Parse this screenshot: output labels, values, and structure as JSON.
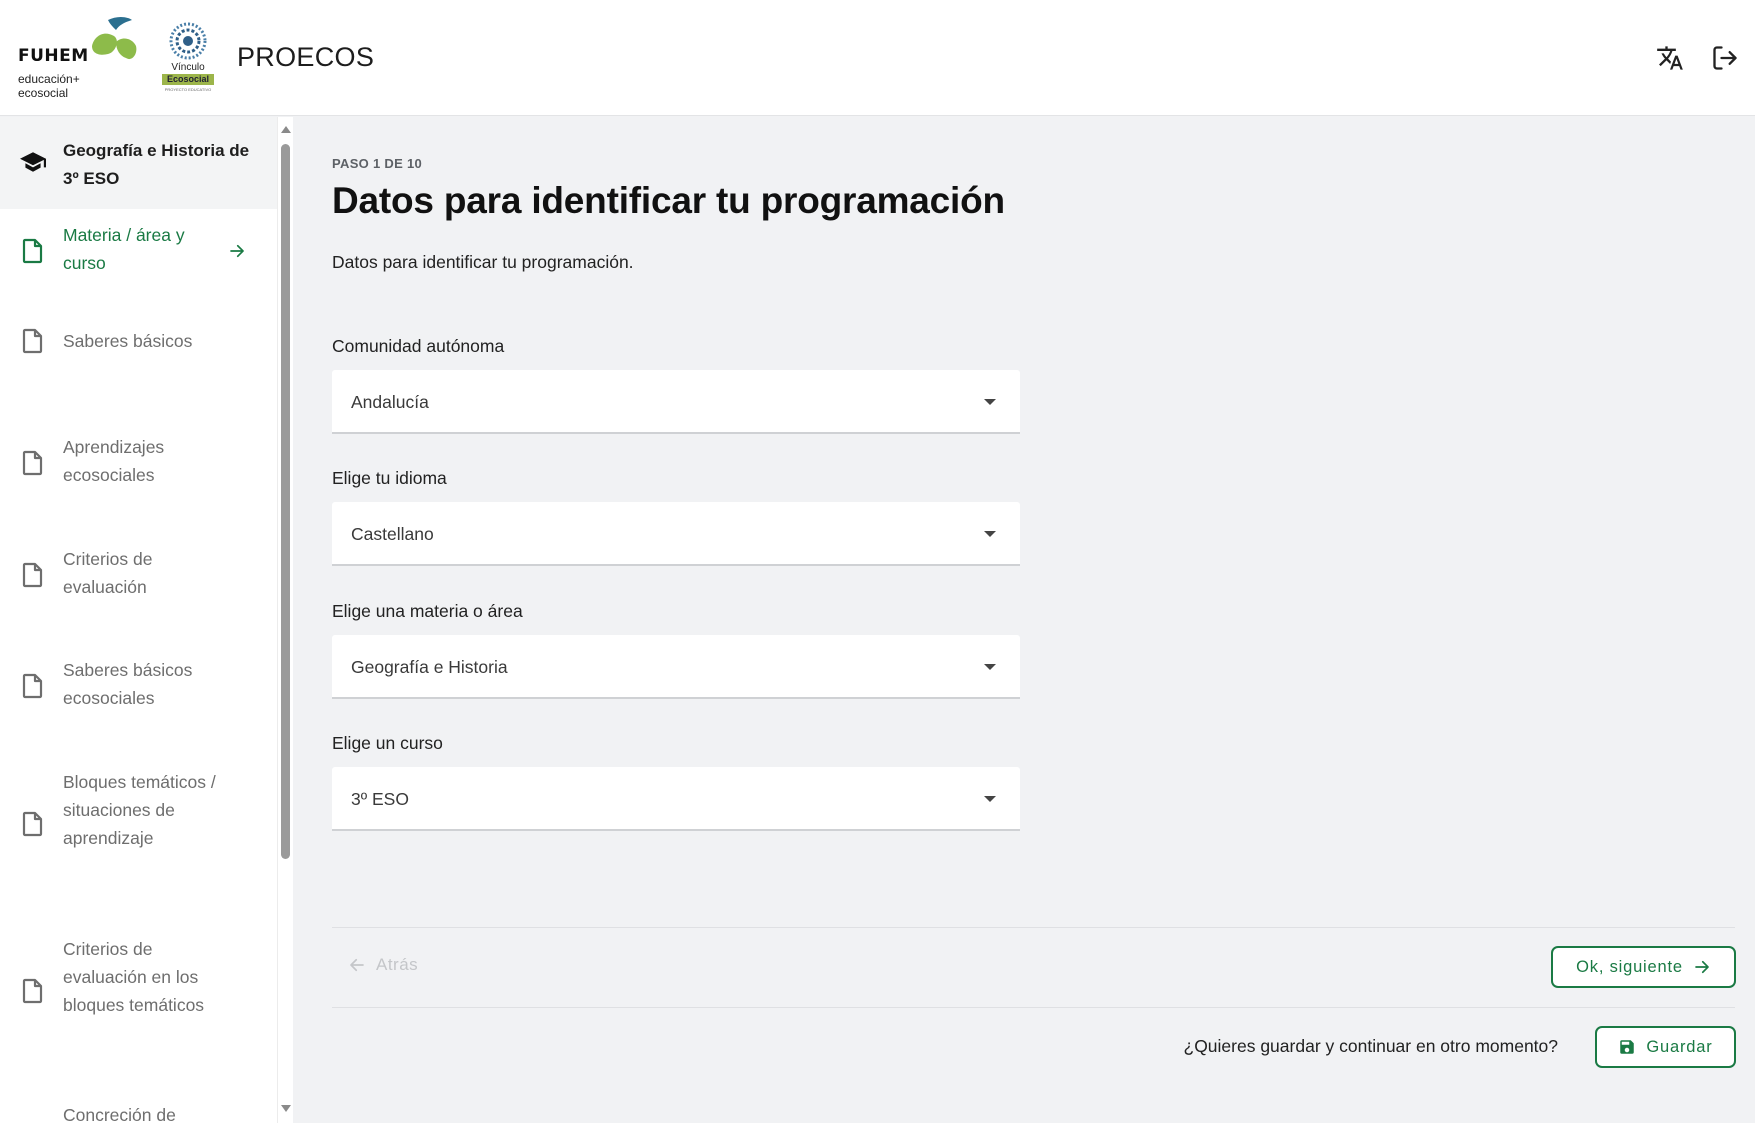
{
  "header": {
    "logo_brand": "FUHEM",
    "logo_sub_1": "educación+",
    "logo_sub_2": "ecosocial",
    "logo2_text": "Vínculo",
    "logo2_bar": "Ecosocial",
    "logo2_small": "PROYECTO EDUCATIVO",
    "app_title": "PROECOS",
    "translate_icon": "translate-icon",
    "logout_icon": "logout-icon"
  },
  "sidebar": {
    "course_title": "Geografía e Historia de 3º ESO",
    "items": [
      {
        "label": "Materia / área y curso",
        "active": true
      },
      {
        "label": "Saberes básicos"
      },
      {
        "label": "Aprendizajes ecosociales"
      },
      {
        "label": "Criterios de evaluación"
      },
      {
        "label": "Saberes básicos ecosociales"
      },
      {
        "label": "Bloques temáticos / situaciones de aprendizaje"
      },
      {
        "label": "Criterios de evaluación en los bloques temáticos"
      },
      {
        "label": "Concreción de"
      }
    ]
  },
  "main": {
    "step": "PASO 1 DE 10",
    "title": "Datos para identificar tu programación",
    "description": "Datos para identificar tu programación.",
    "fields": [
      {
        "label": "Comunidad autónoma",
        "value": "Andalucía"
      },
      {
        "label": "Elige tu idioma",
        "value": "Castellano"
      },
      {
        "label": "Elige una materia o área",
        "value": "Geografía e Historia"
      },
      {
        "label": "Elige un curso",
        "value": "3º ESO"
      }
    ],
    "back_label": "Atrás",
    "next_label": "Ok, siguiente",
    "save_question": "¿Quieres guardar y continuar en otro momento?",
    "save_label": "Guardar"
  },
  "colors": {
    "accent": "#1a7a44",
    "background": "#f1f2f4"
  }
}
